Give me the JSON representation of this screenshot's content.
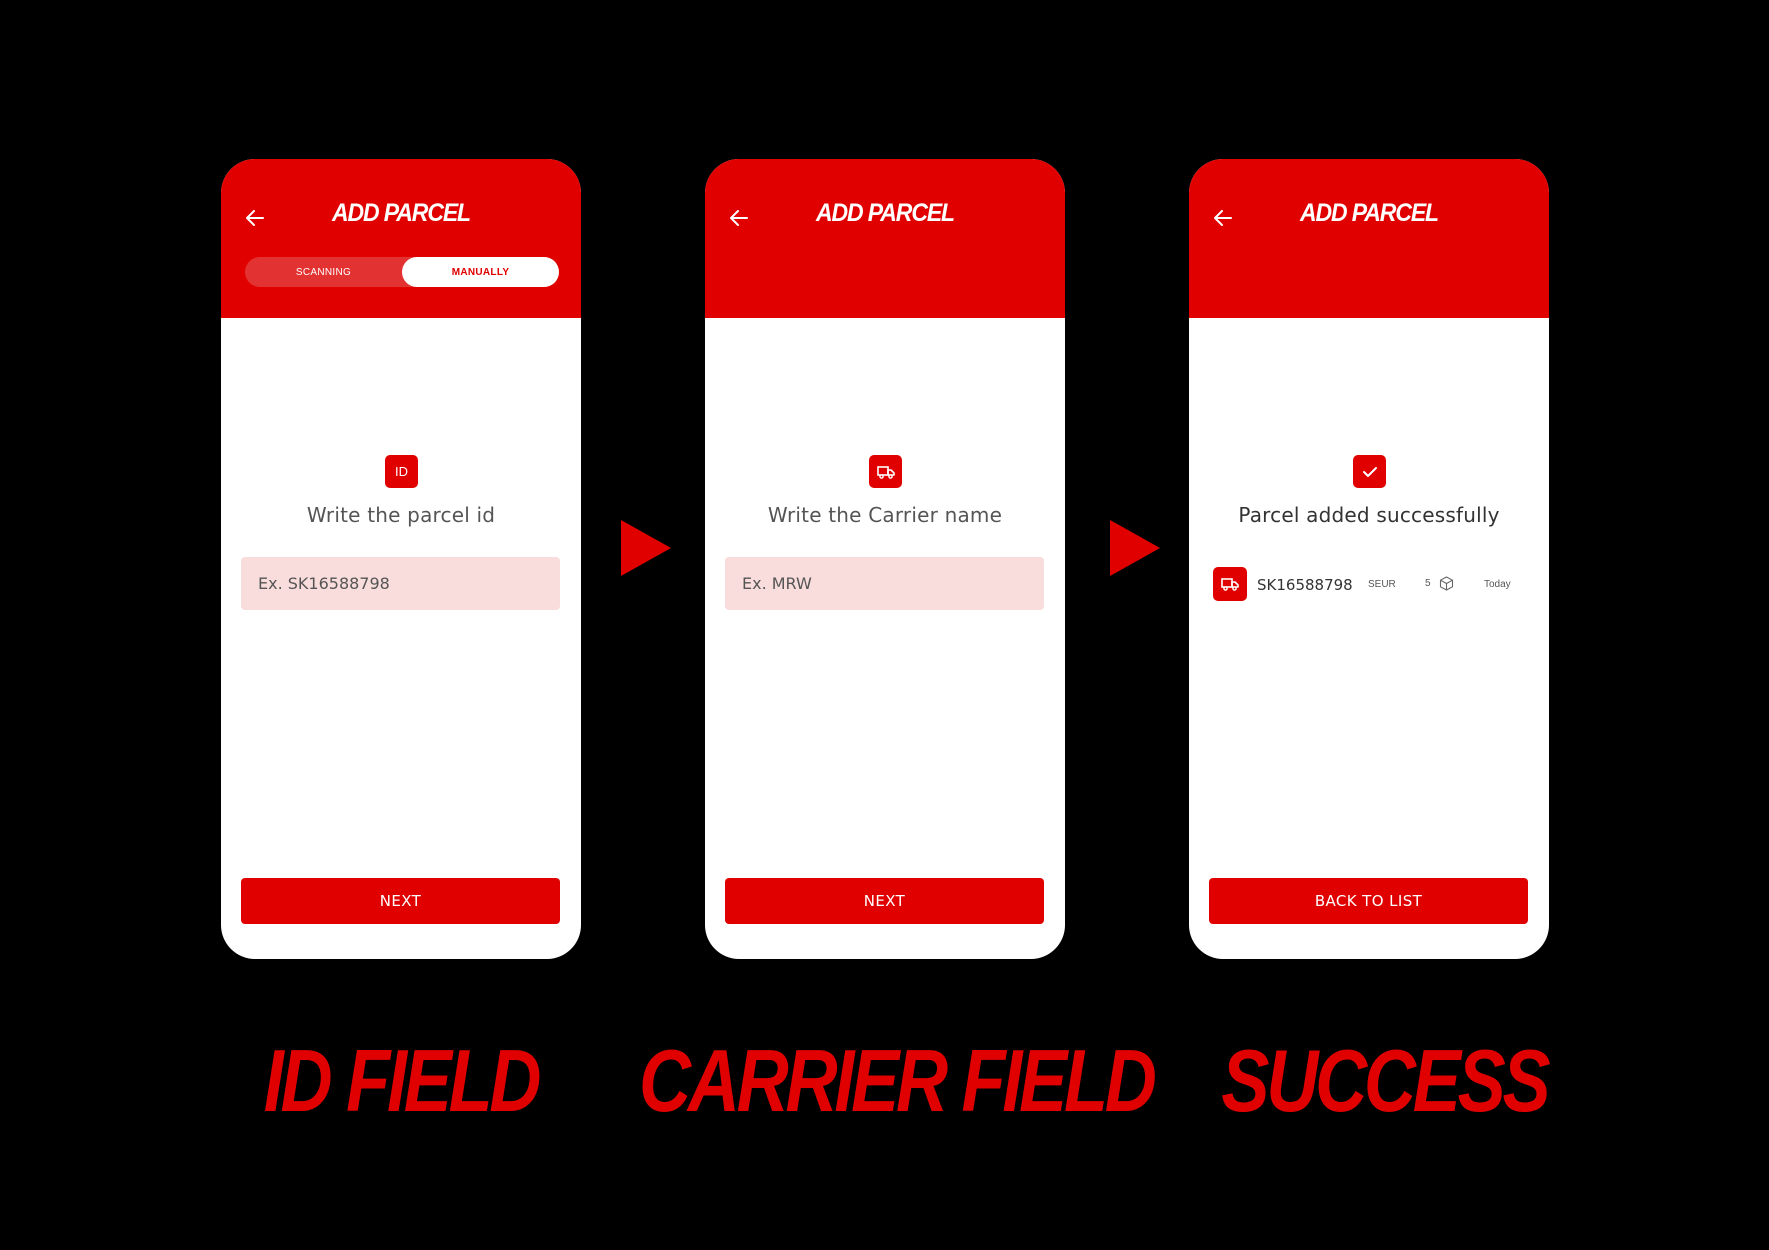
{
  "screens": [
    {
      "title": "ADD PARCEL",
      "toggle": {
        "options": [
          "SCANNING",
          "MANUALLY"
        ],
        "selected": "MANUALLY"
      },
      "icon": "id-icon",
      "icon_text": "ID",
      "prompt": "Write the parcel id",
      "input_placeholder": "Ex. SK16588798",
      "button": "NEXT",
      "caption": "ID FIELD"
    },
    {
      "title": "ADD PARCEL",
      "icon": "truck-icon",
      "prompt": "Write the Carrier name",
      "input_placeholder": "Ex. MRW",
      "button": "NEXT",
      "caption": "CARRIER FIELD"
    },
    {
      "title": "ADD PARCEL",
      "icon": "check-icon",
      "prompt": "Parcel added successfully",
      "result": {
        "icon": "truck-icon",
        "parcel_id": "SK16588798",
        "carrier": "SEUR",
        "count": "5",
        "count_icon": "box-icon",
        "date": "Today"
      },
      "button": "BACK TO LIST",
      "caption": "SUCCESS"
    }
  ],
  "colors": {
    "accent": "#e00000",
    "input_bg": "#f9dcdc",
    "background": "#000000"
  }
}
